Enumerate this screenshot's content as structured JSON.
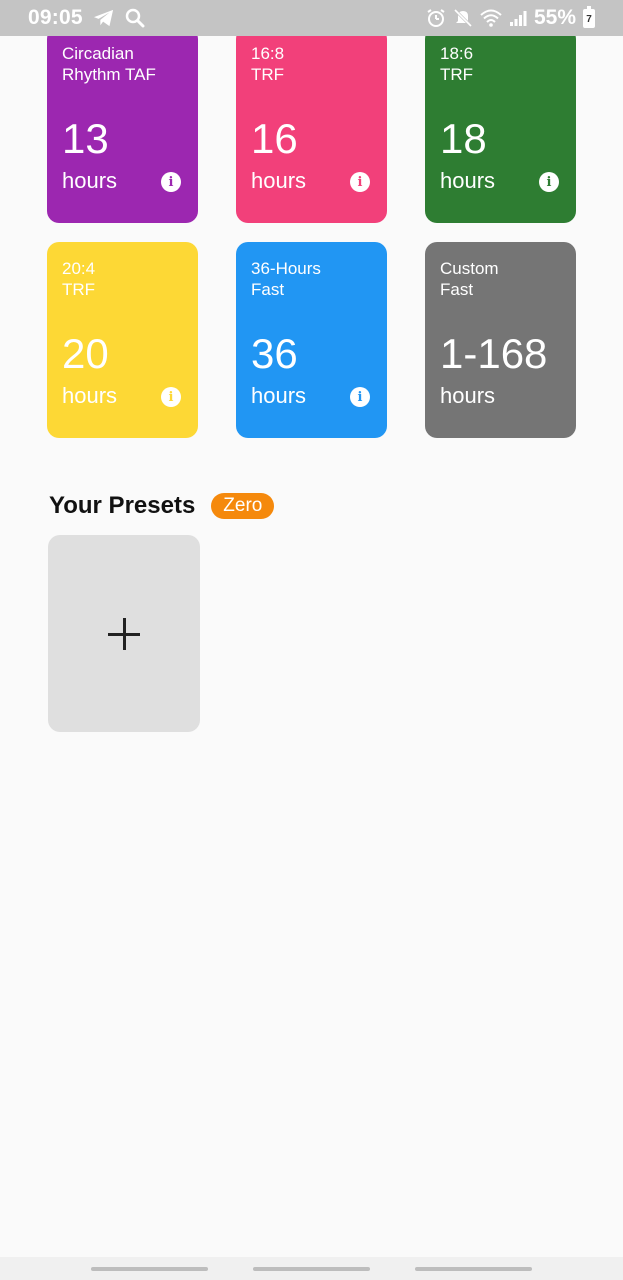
{
  "status_bar": {
    "time": "09:05",
    "battery": "55%",
    "battery_level_label": "7",
    "icons": [
      "telegram-icon",
      "search-icon",
      "alarm-icon",
      "mute-icon",
      "wifi-icon",
      "signal-icon",
      "battery-icon"
    ]
  },
  "colors": {
    "circadian": "#9c27b0",
    "trf_16_8": "#f2407a",
    "trf_18_6": "#2e7d32",
    "trf_20_4": "#fdd835",
    "fast_36": "#2196f3",
    "custom": "#757575",
    "badge": "#f5890c",
    "add_tile": "#dfdfdf"
  },
  "cards": [
    {
      "title_line1": "Circadian",
      "title_line2": "Rhythm TAF",
      "value": "13",
      "unit": "hours",
      "info": "i"
    },
    {
      "title_line1": "16:8",
      "title_line2": "TRF",
      "value": "16",
      "unit": "hours",
      "info": "i"
    },
    {
      "title_line1": "18:6",
      "title_line2": "TRF",
      "value": "18",
      "unit": "hours",
      "info": "i"
    },
    {
      "title_line1": "20:4",
      "title_line2": "TRF",
      "value": "20",
      "unit": "hours",
      "info": "i"
    },
    {
      "title_line1": "36-Hours",
      "title_line2": "Fast",
      "value": "36",
      "unit": "hours",
      "info": "i"
    },
    {
      "title_line1": "Custom",
      "title_line2": "Fast",
      "value": "1-168",
      "unit": "hours"
    }
  ],
  "presets": {
    "title": "Your Presets",
    "badge": "Zero",
    "add_icon": "plus-icon"
  }
}
